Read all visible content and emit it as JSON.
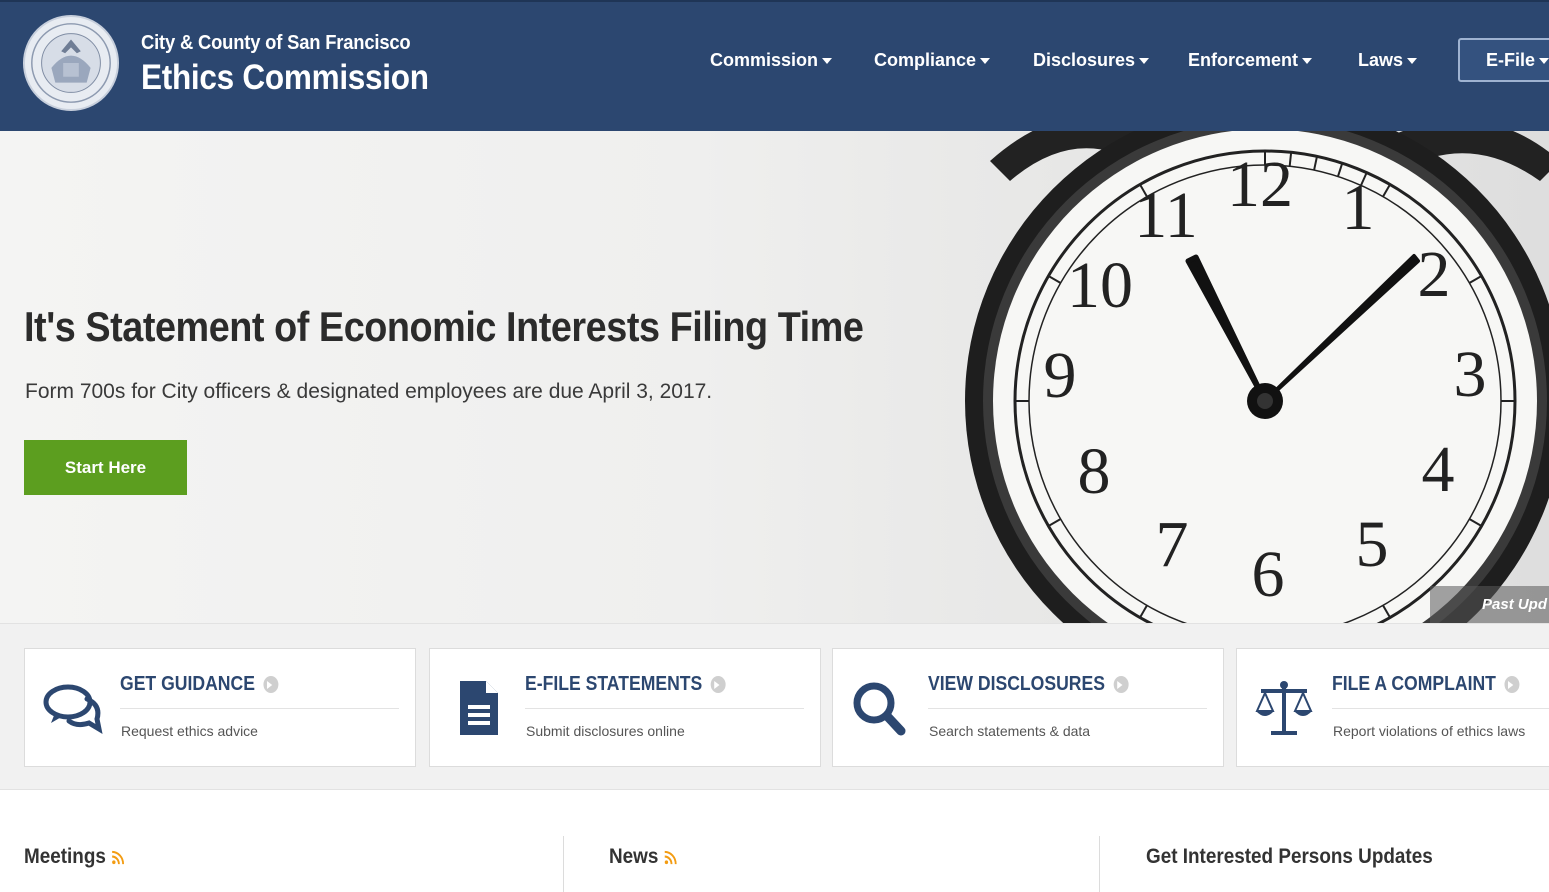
{
  "header": {
    "org_line1": "City & County of San Francisco",
    "org_line2": "Ethics Commission",
    "nav": [
      {
        "label": "Commission"
      },
      {
        "label": "Compliance"
      },
      {
        "label": "Disclosures"
      },
      {
        "label": "Enforcement"
      },
      {
        "label": "Laws"
      }
    ],
    "efile_label": "E-File",
    "colors": {
      "bar": "#2c4770"
    }
  },
  "hero": {
    "title": "It's Statement of Economic Interests Filing Time",
    "subtitle": "Form 700s for City officers & designated employees are due April 3, 2017.",
    "cta_label": "Start Here",
    "past_updates_label": "Past Upd",
    "cta_color": "#5c9e1f"
  },
  "cards": [
    {
      "title": "GET GUIDANCE",
      "description": "Request ethics advice",
      "icon": "chat-bubbles-icon"
    },
    {
      "title": "E-FILE STATEMENTS",
      "description": "Submit disclosures online",
      "icon": "document-icon"
    },
    {
      "title": "VIEW DISCLOSURES",
      "description": "Search statements & data",
      "icon": "magnifier-icon"
    },
    {
      "title": "FILE A COMPLAINT",
      "description": "Report violations of ethics laws",
      "icon": "scales-icon"
    }
  ],
  "bottom": {
    "meetings_label": "Meetings",
    "news_label": "News",
    "updates_label": "Get Interested Persons Updates"
  }
}
